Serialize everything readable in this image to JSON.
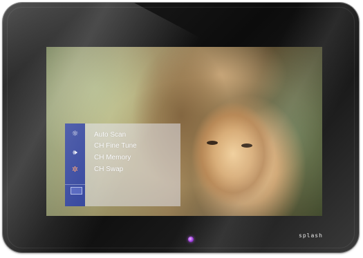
{
  "device": {
    "brand": "splash"
  },
  "osd_menu": {
    "sidebar_icons": [
      {
        "name": "brightness-icon",
        "glyph": "☼"
      },
      {
        "name": "speaker-icon",
        "glyph": "🕪"
      },
      {
        "name": "settings-gear-icon",
        "glyph": "✲"
      },
      {
        "name": "input-source-icon",
        "glyph": "⊟"
      }
    ],
    "items": [
      {
        "label": "Auto Scan"
      },
      {
        "label": "CH Fine Tune"
      },
      {
        "label": "CH Memory"
      },
      {
        "label": "CH Swap"
      }
    ],
    "colors": {
      "sidebar": "#2d3f9a",
      "panel": "#e1e1eb"
    }
  },
  "indicators": {
    "power_led_color": "#a03ee0"
  }
}
